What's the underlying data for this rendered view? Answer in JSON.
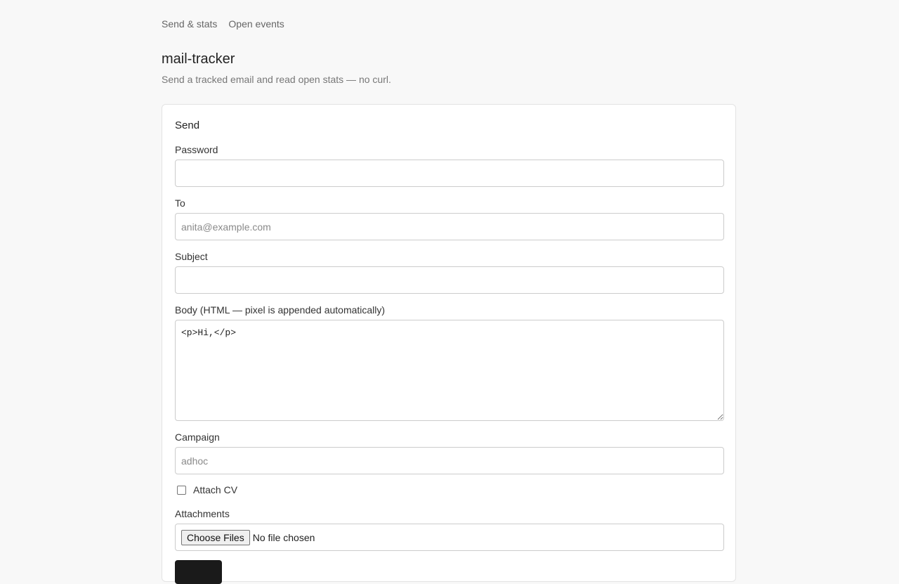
{
  "nav": {
    "items": [
      "Send & stats",
      "Open events"
    ]
  },
  "header": {
    "title": "mail-tracker",
    "subtitle": "Send a tracked email and read open stats — no curl."
  },
  "send_form": {
    "title": "Send",
    "password": {
      "label": "Password",
      "value": "",
      "placeholder": ""
    },
    "to": {
      "label": "To",
      "value": "",
      "placeholder": "anita@example.com"
    },
    "subject": {
      "label": "Subject",
      "value": "",
      "placeholder": ""
    },
    "body": {
      "label": "Body (HTML — pixel is appended automatically)",
      "value": "<p>Hi,</p>"
    },
    "campaign": {
      "label": "Campaign",
      "value": "",
      "placeholder": "adhoc"
    },
    "attach_cv": {
      "label": "Attach CV",
      "checked": false
    },
    "attachments": {
      "label": "Attachments",
      "button_label": "Choose Files",
      "status": "No file chosen"
    }
  },
  "colors": {
    "page_background": "#f8f8f8",
    "card_background": "#ffffff",
    "submit_button": "#1a1a1a"
  }
}
